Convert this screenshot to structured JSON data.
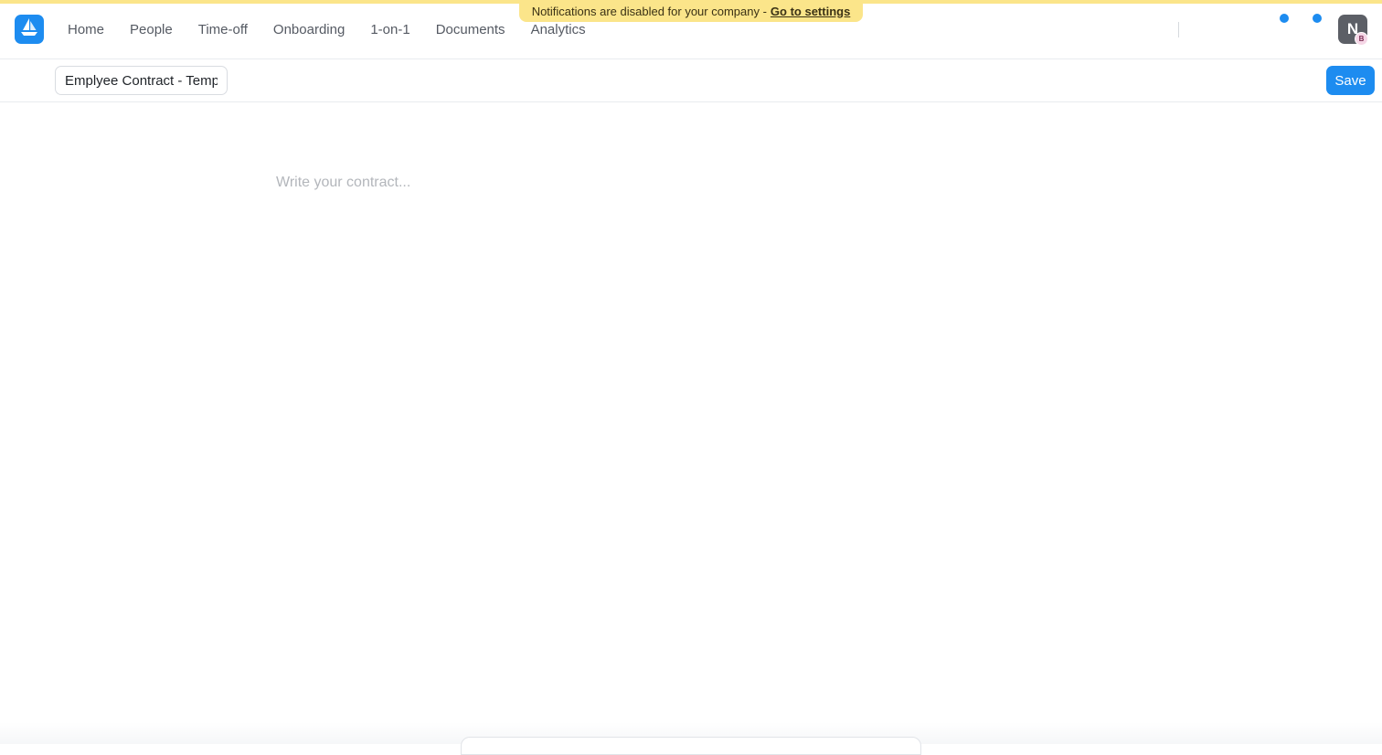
{
  "banner": {
    "message": "Notifications are disabled for your company - ",
    "link": "Go to settings"
  },
  "nav": {
    "items": [
      {
        "label": "Home"
      },
      {
        "label": "People"
      },
      {
        "label": "Time-off"
      },
      {
        "label": "Onboarding"
      },
      {
        "label": "1-on-1"
      },
      {
        "label": "Documents"
      },
      {
        "label": "Analytics"
      }
    ]
  },
  "user": {
    "initial": "N",
    "badge": "B"
  },
  "document": {
    "title_value": "Emplyee Contract - Temp",
    "save_label": "Save",
    "editor_placeholder": "Write your contract..."
  },
  "colors": {
    "accent": "#1d8cf0",
    "banner": "#fbe58a"
  }
}
